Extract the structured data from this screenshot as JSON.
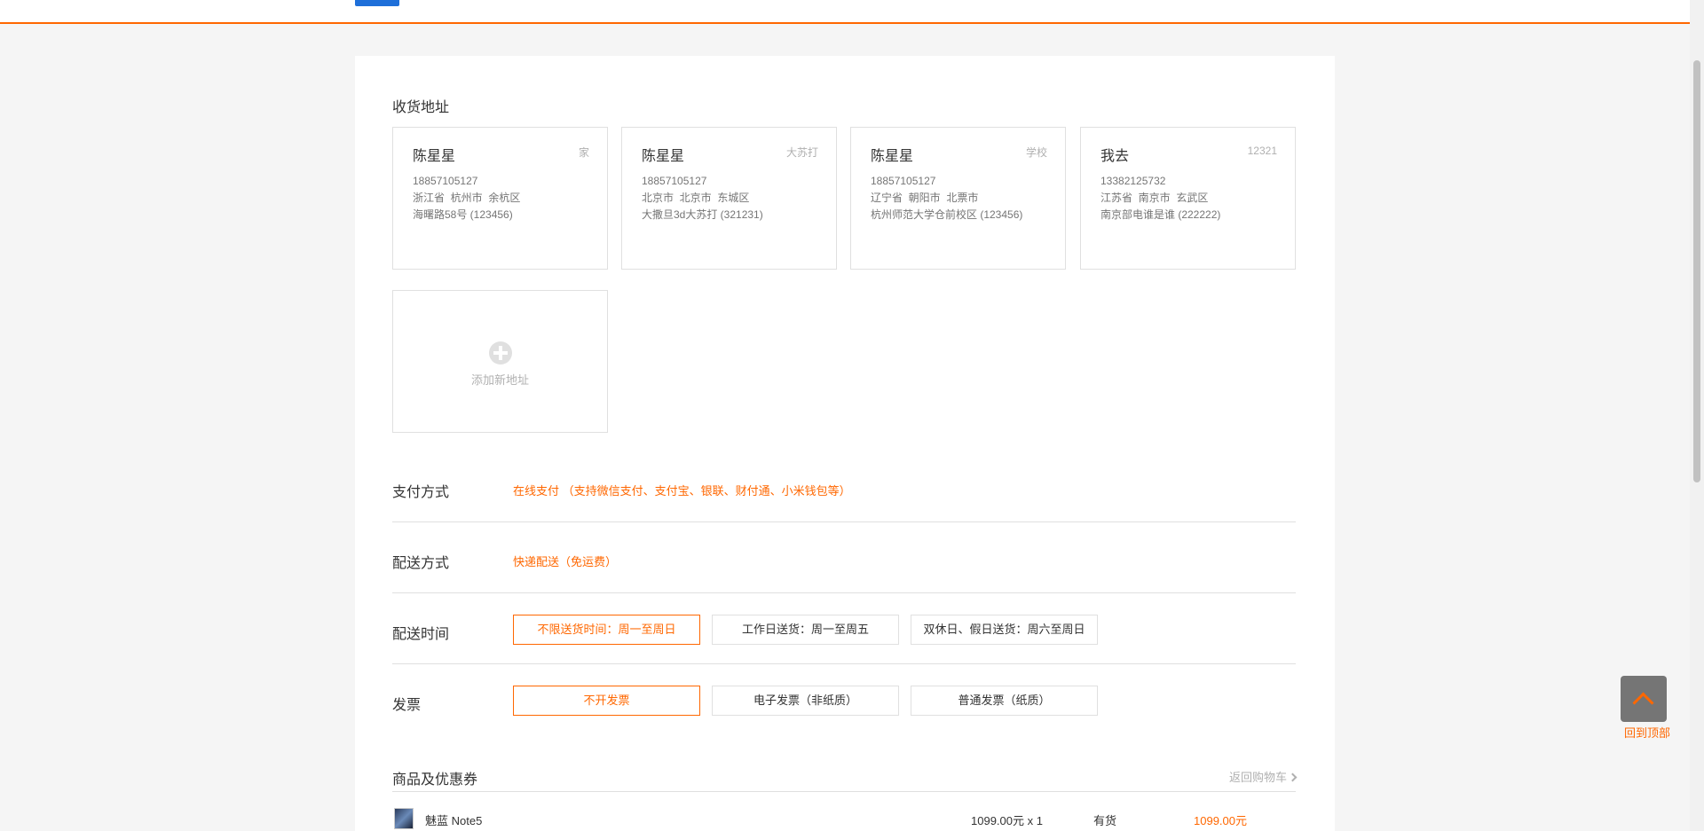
{
  "header": {
    "blue_button": ""
  },
  "address_section": {
    "title": "收货地址",
    "cards": [
      {
        "name": "陈星星",
        "tag": "家",
        "phone": "18857105127",
        "region": "浙江省  杭州市  余杭区",
        "detail": "海曙路58号 (123456)"
      },
      {
        "name": "陈星星",
        "tag": "大苏打",
        "phone": "18857105127",
        "region": "北京市  北京市  东城区",
        "detail": "大撒旦3d大苏打 (321231)"
      },
      {
        "name": "陈星星",
        "tag": "学校",
        "phone": "18857105127",
        "region": "辽宁省  朝阳市  北票市",
        "detail": "杭州师范大学仓前校区 (123456)"
      },
      {
        "name": "我去",
        "tag": "12321",
        "phone": "13382125732",
        "region": "江苏省  南京市  玄武区",
        "detail": "南京部电谁是谁 (222222)"
      }
    ],
    "add_label": "添加新地址"
  },
  "payment": {
    "label": "支付方式",
    "value": "在线支付 （支持微信支付、支付宝、银联、财付通、小米钱包等）"
  },
  "shipping": {
    "label": "配送方式",
    "value": "快递配送（免运费）"
  },
  "delivery_time": {
    "label": "配送时间",
    "options": [
      "不限送货时间：周一至周日",
      "工作日送货：周一至周五",
      "双休日、假日送货：周六至周日"
    ],
    "selected": 0
  },
  "invoice": {
    "label": "发票",
    "options": [
      "不开发票",
      "电子发票（非纸质）",
      "普通发票（纸质）"
    ],
    "selected": 0
  },
  "products": {
    "title": "商品及优惠券",
    "back_to_cart": "返回购物车",
    "items": [
      {
        "name": "魅蓝 Note5",
        "price": "1099.00元 x 1",
        "stock": "有货",
        "total": "1099.00元"
      }
    ]
  },
  "back_to_top": {
    "label": "回到顶部"
  },
  "colors": {
    "accent": "#ff6700",
    "border": "#e0e0e0",
    "muted": "#b0b0b0",
    "blue": "#1e6fd9"
  }
}
